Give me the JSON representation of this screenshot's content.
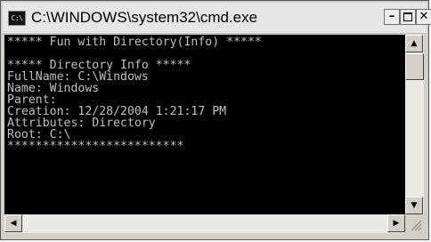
{
  "window": {
    "title": "C:\\WINDOWS\\system32\\cmd.exe",
    "icon_label": "C:\\"
  },
  "controls": {
    "minimize": "–",
    "close": "✕"
  },
  "console": {
    "lines": [
      "***** Fun with Directory(Info) *****",
      "",
      "***** Directory Info *****",
      "FullName: C:\\Windows",
      "Name: Windows",
      "Parent:",
      "Creation: 12/28/2004 1:21:17 PM",
      "Attributes: Directory",
      "Root: C:\\",
      "*************************"
    ]
  },
  "scrollbars": {
    "up_arrow": "▲",
    "down_arrow": "▼",
    "left_arrow": "◀",
    "right_arrow": "▶"
  },
  "icons": [
    "console-app-icon",
    "minimize-icon",
    "close-icon",
    "resize-grip-icon"
  ],
  "colors": {
    "console_bg": "#000000",
    "console_text": "#c0c0c0",
    "chrome": "#d4d0c8"
  }
}
